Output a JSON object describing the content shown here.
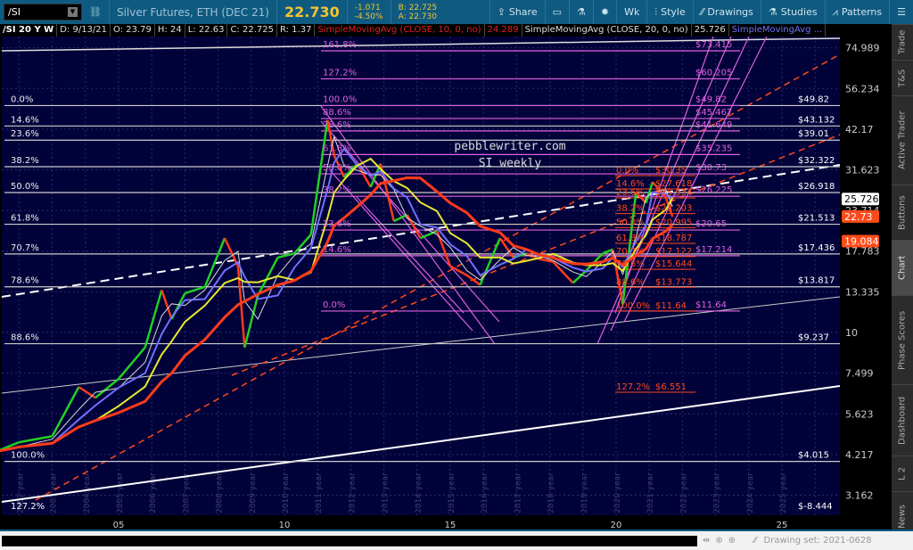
{
  "toolbar": {
    "symbol": "/SI",
    "description": "Silver Futures, ETH (DEC 21)",
    "last": "22.730",
    "change": "-1.071",
    "change_pct": "-4.50%",
    "bid": "B: 22.725",
    "ask": "A: 22.730",
    "share": "Share",
    "aggregation": "Wk",
    "style": "Style",
    "drawings": "Drawings",
    "studies": "Studies",
    "patterns": "Patterns"
  },
  "info": {
    "symbol": "/SI 20 Y W",
    "date": "D: 9/13/21",
    "open": "O: 23.79",
    "high": "H: 24",
    "low": "L: 22.63",
    "close": "C: 22.725",
    "range": "R: 1.37",
    "sma10": "SimpleMovingAvg (CLOSE, 10, 0, no)",
    "sma10_val": "24.289",
    "sma20": "SimpleMovingAvg (CLOSE, 20, 0, no)",
    "sma20_val": "25.726",
    "sma3": "SimpleMovingAvg ..."
  },
  "side_tabs": [
    "Trade",
    "T&S",
    "Active Trader",
    "Buttons",
    "Chart",
    "Phase Scores",
    "Dashboard",
    "L 2",
    "News"
  ],
  "bottom": {
    "drawing_set": "Drawing set: 2021-0628"
  },
  "colors": {
    "bg": "#02023a",
    "magenta": "#e060e0",
    "red_fib": "#ff4a1a",
    "sma10": "#ff3b1a",
    "sma20": "#e8e830",
    "sma3": "#7070ff"
  },
  "chart_data": {
    "type": "line",
    "title": "pebblewriter.com",
    "subtitle": "SI weekly",
    "yscale": "log",
    "ylim": [
      2.9,
      86
    ],
    "xlim": [
      2001.3,
      2026.7
    ],
    "x_ticks": [
      "05",
      "10",
      "15",
      "20",
      "25"
    ],
    "y_ticks": [
      "74.989",
      "56.234",
      "42.17",
      "31.623",
      "23.714",
      "17.783",
      "13.335",
      "10",
      "7.499",
      "5.623",
      "4.217",
      "3.162"
    ],
    "year_labels": [
      "2001 year",
      "2002 year",
      "2003 year",
      "2004 year",
      "2005 year",
      "2006 year",
      "2007 year",
      "2008 year",
      "2009 year",
      "2010 year",
      "2011 year",
      "2012 year",
      "2013 year",
      "2014 year",
      "2015 year",
      "2016 year",
      "2017 year",
      "2018 year",
      "2019 year",
      "2020 year",
      "2021 year",
      "2022 year",
      "2023 year",
      "2024 year",
      "2025 year"
    ],
    "price_badges": [
      {
        "label": "25.726",
        "color": "#ffffff"
      },
      {
        "label": "22.73",
        "color": "#ff4a1a"
      },
      {
        "label": "19.084",
        "color": "#ff4a1a"
      }
    ],
    "price": {
      "x": [
        2001.3,
        2002,
        2003,
        2003.8,
        2004.3,
        2005,
        2005.8,
        2006.3,
        2006.6,
        2007,
        2007.6,
        2008.2,
        2008.6,
        2008.8,
        2009.2,
        2009.8,
        2010.3,
        2010.8,
        2011.3,
        2011.5,
        2011.8,
        2012.2,
        2012.6,
        2012.9,
        2013.3,
        2013.7,
        2014.1,
        2014.6,
        2015,
        2015.5,
        2015.9,
        2016.5,
        2016.9,
        2017.3,
        2017.7,
        2018.1,
        2018.7,
        2019.1,
        2019.6,
        2019.9,
        2020.2,
        2020.6,
        2020.9,
        2021.1,
        2021.5,
        2021.7
      ],
      "y": [
        4.3,
        4.6,
        4.8,
        6.8,
        6.3,
        7.2,
        9,
        13.5,
        11,
        13.2,
        13.8,
        19.5,
        16,
        9,
        13,
        17,
        17.5,
        20,
        45,
        35,
        30,
        33,
        28,
        33,
        22,
        23,
        19.5,
        20.5,
        16,
        15,
        14,
        19.5,
        17,
        17.5,
        16.8,
        16.5,
        14.2,
        15.5,
        17.5,
        18,
        12.2,
        27,
        25,
        29,
        26,
        22.7
      ]
    },
    "sma10_val": 24.289,
    "sma20_val": 25.726,
    "fib_white": [
      [
        "0.0%",
        "$49.82",
        49.82
      ],
      [
        "14.6%",
        "$43.132",
        43.132
      ],
      [
        "23.6%",
        "$39.01",
        39.01
      ],
      [
        "38.2%",
        "$32.322",
        32.322
      ],
      [
        "50.0%",
        "$26.918",
        26.918
      ],
      [
        "61.8%",
        "$21.513",
        21.513
      ],
      [
        "70.7%",
        "$17.436",
        17.436
      ],
      [
        "78.6%",
        "$13.817",
        13.817
      ],
      [
        "88.6%",
        "$9.237",
        9.237
      ],
      [
        "100.0%",
        "$4.015",
        4.015
      ],
      [
        "127.2%",
        "$-8.444",
        null
      ]
    ],
    "fib_magenta": [
      [
        "161.8%",
        "$73.415",
        73.415
      ],
      [
        "127.2%",
        "$60.205",
        60.205
      ],
      [
        "100.0%",
        "$49.82",
        49.82
      ],
      [
        "88.6%",
        "$45.467",
        45.467
      ],
      [
        "78.6%",
        "$41.649",
        41.649
      ],
      [
        "61.8%",
        "$35.235",
        35.235
      ],
      [
        "50.0%",
        "$30.73",
        30.73
      ],
      [
        "38.2%",
        "$26.225",
        26.225
      ],
      [
        "23.6%",
        "$20.65",
        20.65
      ],
      [
        "14.6%",
        "$17.214",
        17.214
      ],
      [
        "0.0%",
        "$11.64",
        11.64
      ]
    ],
    "fib_red": [
      [
        "0.0%",
        "$30.35",
        30.35
      ],
      [
        "14.6%",
        "$27.618",
        27.618
      ],
      [
        "23.6%",
        "$25.934",
        25.934
      ],
      [
        "38.2%",
        "$23.203",
        23.203
      ],
      [
        "50.0%",
        "$20.995",
        20.995
      ],
      [
        "61.8%",
        "$18.787",
        18.787
      ],
      [
        "70.7%",
        "$17.122",
        17.122
      ],
      [
        "78.6%",
        "$15.644",
        15.644
      ],
      [
        "88.6%",
        "$13.773",
        13.773
      ],
      [
        "100.0%",
        "$11.64",
        11.64
      ],
      [
        "127.2%",
        "$6.551",
        6.551
      ]
    ]
  }
}
